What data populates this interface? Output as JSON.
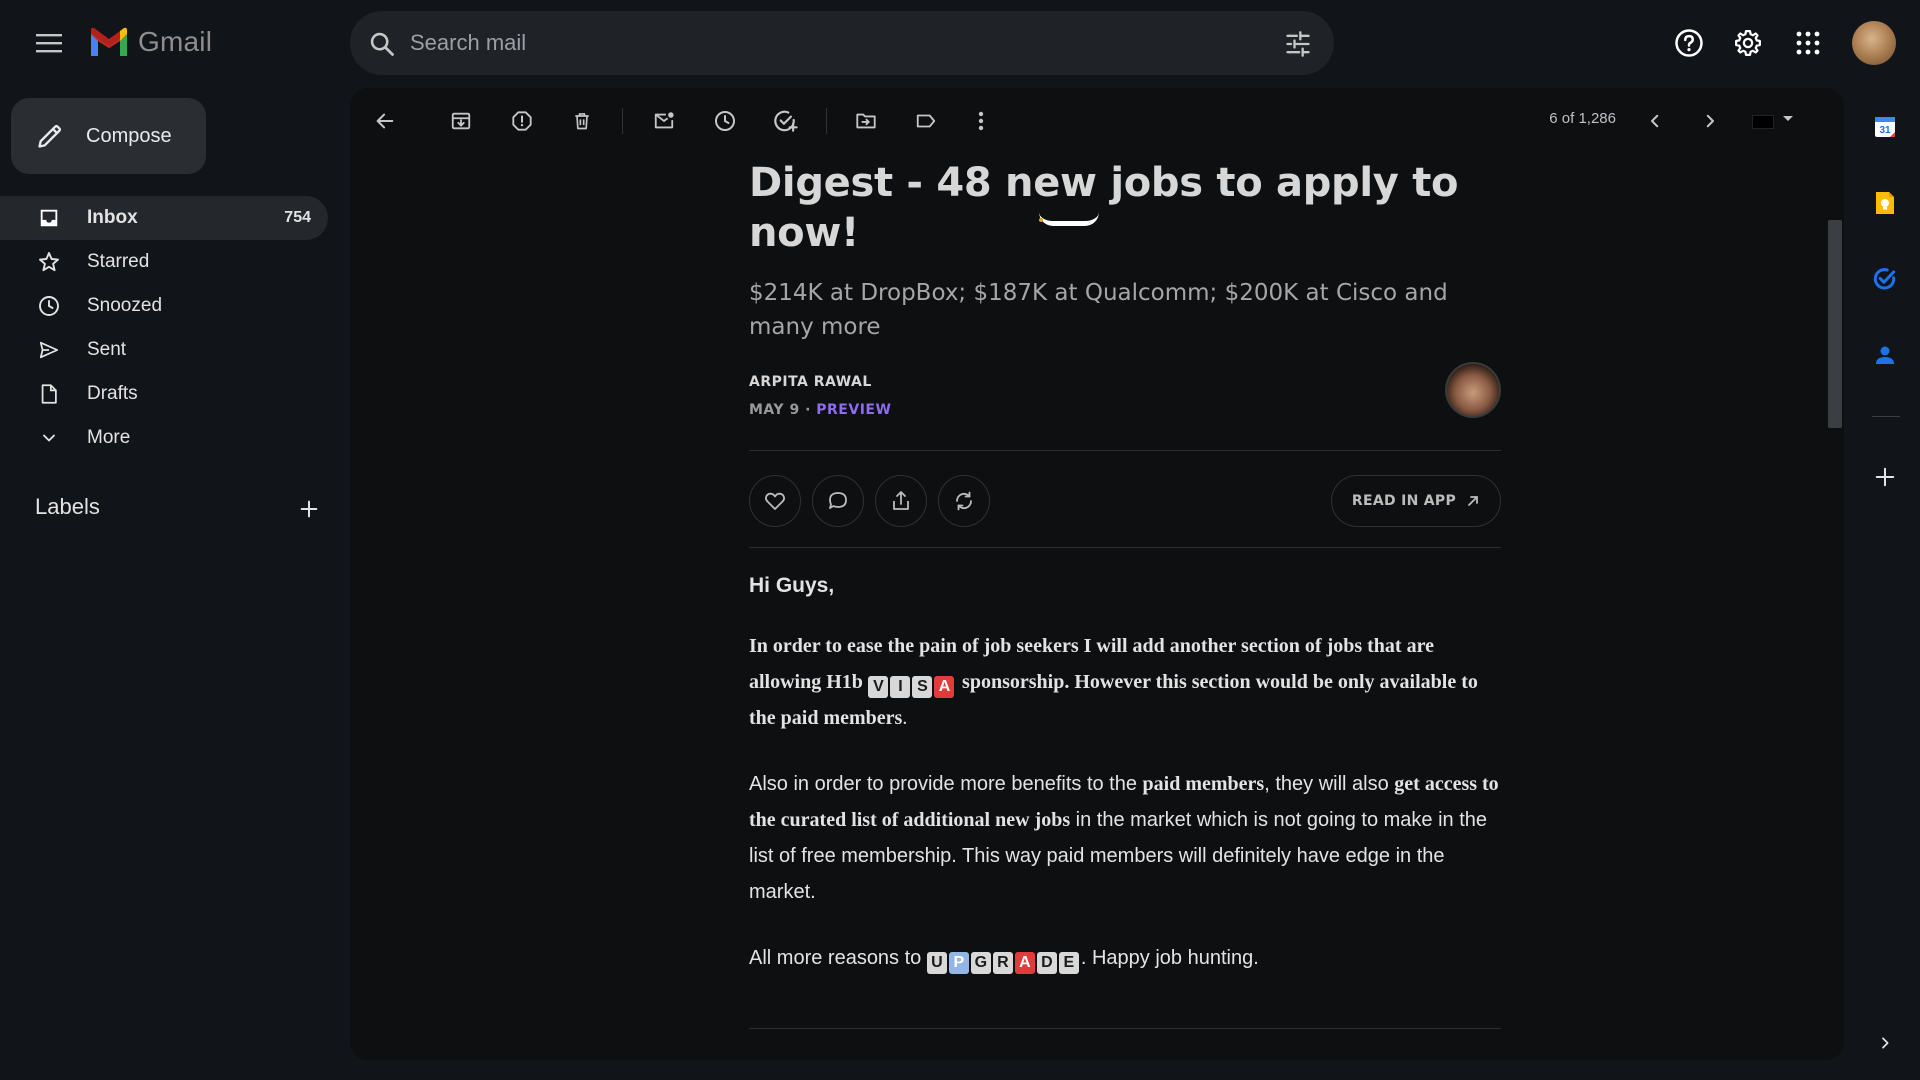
{
  "app": {
    "name": "Gmail"
  },
  "search": {
    "placeholder": "Search mail"
  },
  "compose": {
    "label": "Compose"
  },
  "nav": [
    {
      "label": "Inbox",
      "count": "754",
      "icon": "inbox-icon",
      "active": true
    },
    {
      "label": "Starred",
      "count": "",
      "icon": "star-icon"
    },
    {
      "label": "Snoozed",
      "count": "",
      "icon": "clock-icon"
    },
    {
      "label": "Sent",
      "count": "",
      "icon": "send-icon"
    },
    {
      "label": "Drafts",
      "count": "",
      "icon": "draft-icon"
    },
    {
      "label": "More",
      "count": "",
      "icon": "chevron-down-icon"
    }
  ],
  "labels": {
    "title": "Labels"
  },
  "toolbar": {
    "pager": "6 of 1,286",
    "icons": [
      "back-icon",
      "archive-icon",
      "report-spam-icon",
      "delete-icon",
      "mark-unread-icon",
      "snooze-icon",
      "add-task-icon",
      "move-to-icon",
      "label-icon",
      "more-vert-icon",
      "prev-icon",
      "next-icon"
    ]
  },
  "email": {
    "title": "Digest - 48 new jobs to apply to now!",
    "subtitle": "$214K at DropBox; $187K at Qualcomm; $200K at Cisco and many more",
    "author": "ARPITA RAWAL",
    "date": "MAY 9",
    "dot": "·",
    "preview": "PREVIEW",
    "read_in_app": "READ IN APP",
    "greeting": "Hi Guys,",
    "p1": {
      "a": "In order to ease the pain of job seekers I will add another section of jobs that are allowing H1b",
      "tiles": [
        "V",
        "I",
        "S",
        "A"
      ],
      "b": "sponsorship",
      "c": ". However this section would be only available to the paid members",
      "d": "."
    },
    "p2": {
      "a": "Also in order to provide more benefits to the ",
      "b": "paid members",
      "c": ", they will also ",
      "d": "get access to the curated list of additional new jobs",
      "e": " in the market which is not going to make in the list of free membership. This way paid members will definitely have edge in the market."
    },
    "p3": {
      "a": "All more reasons to ",
      "tiles": [
        "U",
        "P",
        "G",
        "R",
        "A",
        "D",
        "E"
      ],
      "b": ". Happy job hunting."
    }
  },
  "colors": {
    "accent_preview": "#8d6cf0",
    "background": "#111418",
    "pane": "#0d0f11"
  }
}
